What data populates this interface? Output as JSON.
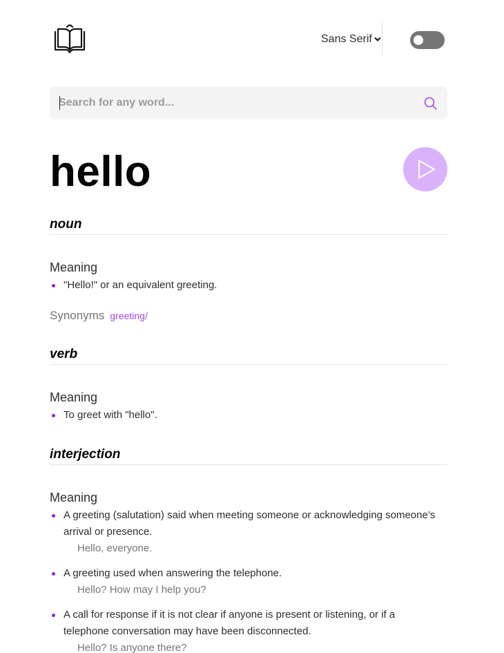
{
  "header": {
    "font_label": "Sans Serif",
    "icons": {
      "logo": "book-icon",
      "dropdown": "chevron-down-icon",
      "theme": "toggle-switch"
    }
  },
  "search": {
    "placeholder": "Search for any word...",
    "value": "",
    "icon": "search-icon"
  },
  "word": {
    "text": "hello",
    "play_icon": "play-icon"
  },
  "colors": {
    "accent": "#a445ed",
    "play_bg": "#d9b2fb",
    "toggle_bg": "#757575",
    "search_bg": "#f4f4f5"
  },
  "sections": [
    {
      "part_of_speech": "noun",
      "meaning_label": "Meaning",
      "definitions": [
        {
          "text": "\"Hello!\" or an equivalent greeting."
        }
      ],
      "synonyms_label": "Synonyms",
      "synonyms": [
        "greeting/"
      ]
    },
    {
      "part_of_speech": "verb",
      "meaning_label": "Meaning",
      "definitions": [
        {
          "text": "To greet with \"hello\"."
        }
      ]
    },
    {
      "part_of_speech": "interjection",
      "meaning_label": "Meaning",
      "definitions": [
        {
          "text": "A greeting (salutation) said when meeting someone or acknowledging someone’s arrival or presence.",
          "example": "Hello, everyone."
        },
        {
          "text": "A greeting used when answering the telephone.",
          "example": "Hello? How may I help you?"
        },
        {
          "text": "A call for response if it is not clear if anyone is present or listening, or if a telephone conversation may have been disconnected.",
          "example": "Hello? Is anyone there?"
        }
      ]
    }
  ]
}
